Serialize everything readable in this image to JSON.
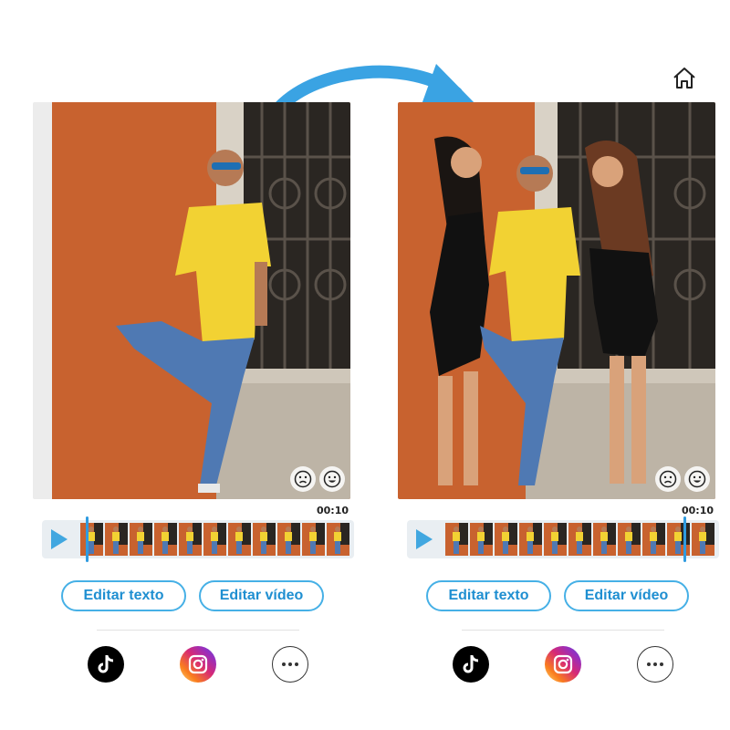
{
  "left_panel": {
    "time": "00:10",
    "buttons": {
      "edit_text": "Editar texto",
      "edit_video": "Editar vídeo"
    },
    "icons": [
      "sad-face-icon",
      "happy-face-icon",
      "play-icon",
      "tiktok-icon",
      "instagram-icon",
      "more-icon"
    ],
    "playhead_progress": 0.02
  },
  "right_panel": {
    "time": "00:10",
    "buttons": {
      "edit_text": "Editar texto",
      "edit_video": "Editar vídeo"
    },
    "icons": [
      "sad-face-icon",
      "happy-face-icon",
      "play-icon",
      "tiktok-icon",
      "instagram-icon",
      "more-icon",
      "home-icon"
    ],
    "playhead_progress": 0.9
  },
  "colors": {
    "accent": "#41a7e0",
    "arrow": "#3aa3e3",
    "wall": "#c8622f",
    "shirt": "#f2d233"
  }
}
